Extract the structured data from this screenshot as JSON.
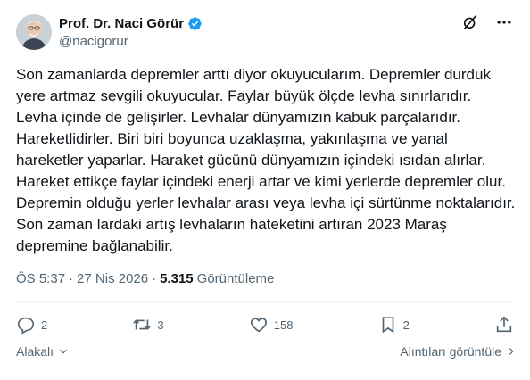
{
  "author": {
    "name": "Prof. Dr. Naci Görür",
    "handle": "@nacigorur",
    "verified_color": "#1d9bf0"
  },
  "post": {
    "text": "Son zamanlarda depremler arttı diyor okuyucularım. Depremler durduk yere artmaz sevgili okuyucular. Faylar büyük ölçde levha sınırlarıdır. Levha içinde de gelişirler. Levhalar dünyamızın kabuk parçalarıdır. Hareketlidirler. Biri biri boyunca uzaklaşma, yakınlaşma ve yanal hareketler yaparlar. Haraket gücünü dünyamızın içindeki ısıdan alırlar. Hareket ettikçe faylar içindeki enerji artar ve kimi yerlerde depremler olur. Depremin olduğu yerler levhalar arası veya levha içi sürtünme noktalarıdır.  Son zaman lardaki artış levhaların hateketini artıran 2023 Maraş depremine bağlanabilir."
  },
  "meta": {
    "time": "ÖS 5:37",
    "sep1": "·",
    "date": "27 Nis 2026",
    "sep2": "·",
    "views_count": "5.315",
    "views_label": "Görüntüleme"
  },
  "actions": {
    "replies": "2",
    "reposts": "3",
    "likes": "158",
    "bookmarks": "2"
  },
  "footer": {
    "related_label": "Alakalı",
    "quotes_label": "Alıntıları görüntüle"
  },
  "icons": {
    "grok": "grok-icon",
    "more": "more-icon",
    "reply": "reply-icon",
    "repost": "repost-icon",
    "like": "heart-icon",
    "bookmark": "bookmark-icon",
    "share": "share-icon"
  }
}
